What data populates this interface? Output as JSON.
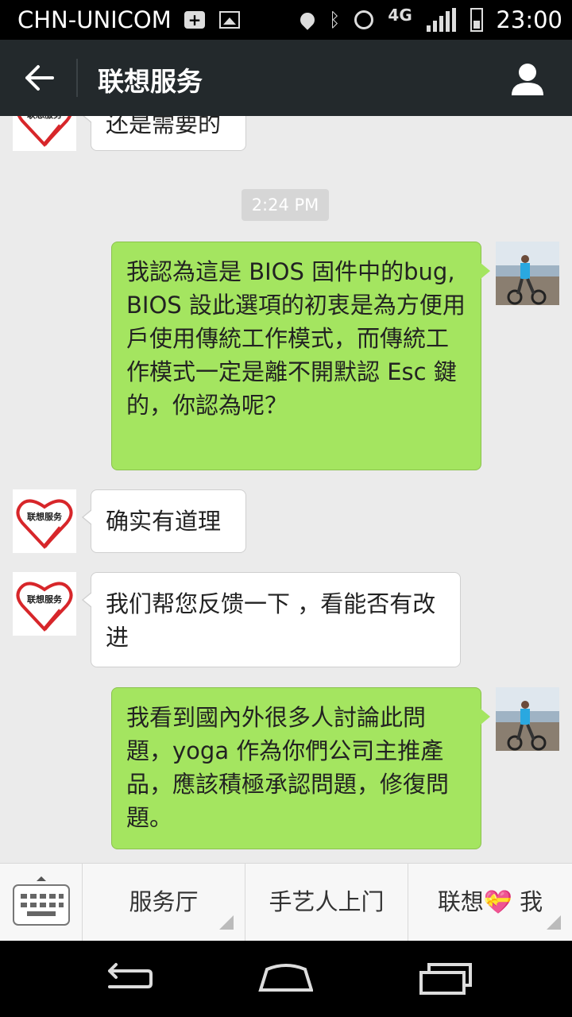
{
  "status_bar": {
    "carrier": "CHN-UNICOM",
    "network": "4G",
    "time": "23:00",
    "icons": [
      "plus-box-icon",
      "image-icon",
      "location-icon",
      "bluetooth-icon",
      "alarm-icon",
      "signal-icon",
      "battery-icon"
    ]
  },
  "header": {
    "title": "联想服务",
    "back_icon": "back-arrow-icon",
    "profile_icon": "person-icon"
  },
  "chat": {
    "messages": [
      {
        "side": "left",
        "text": "还是需要的"
      },
      {
        "side": "time",
        "text": "2:24 PM"
      },
      {
        "side": "right",
        "text": "我認為這是 BIOS 固件中的bug, BIOS 設此選項的初衷是為方便用戶使用傳統工作模式，而傳統工作模式一定是離不開默認 Esc 鍵的，你認為呢？"
      },
      {
        "side": "left",
        "text": "确实有道理"
      },
      {
        "side": "left",
        "text": "我们帮您反馈一下 ，看能否有改进"
      },
      {
        "side": "right",
        "text": "我看到國內外很多人討論此問題，yoga 作為你們公司主推產品，應該積極承認問題，修復問題。"
      }
    ],
    "brand_avatar_text": "联想服务"
  },
  "bottom_menu": {
    "keyboard_icon": "keyboard-icon",
    "items": [
      {
        "label": "服务厅"
      },
      {
        "label": "手艺人上门"
      },
      {
        "label": "联想💝 我"
      }
    ]
  },
  "nav_bar": {
    "icons": [
      "back-nav-icon",
      "home-nav-icon",
      "recents-nav-icon"
    ]
  },
  "colors": {
    "title_bar": "#23292c",
    "chat_bg": "#ebebeb",
    "sent_bubble": "#a4e560",
    "received_bubble": "#ffffff",
    "brand_red": "#d7262a"
  }
}
